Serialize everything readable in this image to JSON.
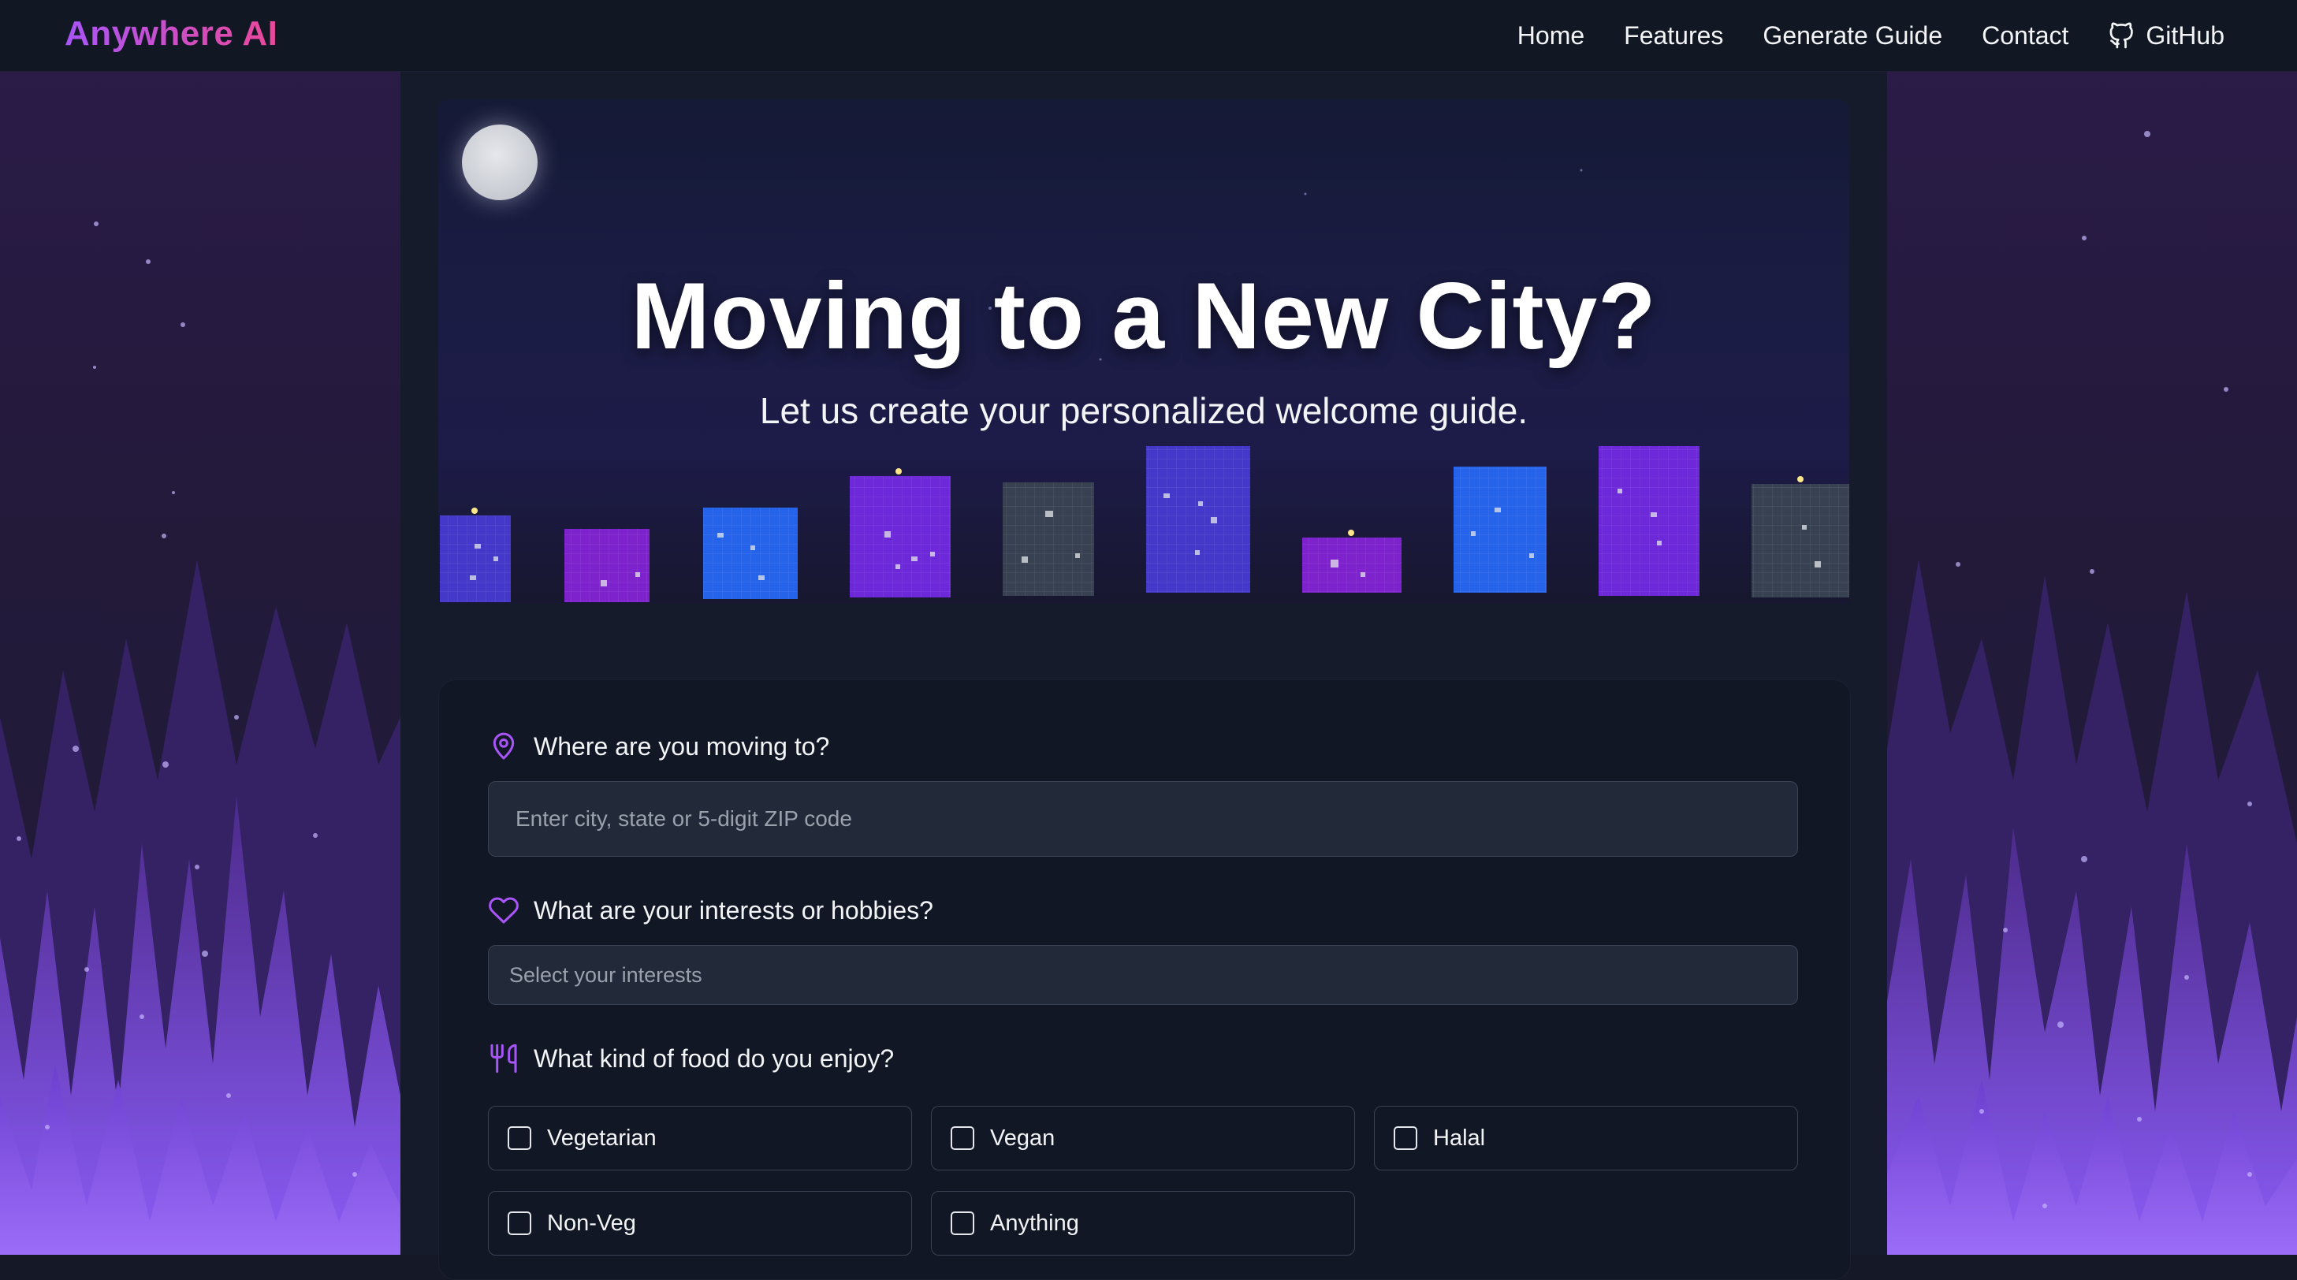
{
  "nav": {
    "brand": "Anywhere AI",
    "links": [
      "Home",
      "Features",
      "Generate Guide",
      "Contact"
    ],
    "github_label": "GitHub"
  },
  "hero": {
    "title": "Moving to a New City?",
    "subtitle": "Let us create your personalized welcome guide."
  },
  "form": {
    "location": {
      "label": "Where are you moving to?",
      "placeholder": "Enter city, state or 5-digit ZIP code"
    },
    "interests": {
      "label": "What are your interests or hobbies?",
      "placeholder": "Select your interests"
    },
    "food": {
      "label": "What kind of food do you enjoy?",
      "options": [
        "Vegetarian",
        "Vegan",
        "Halal",
        "Non-Veg",
        "Anything"
      ]
    }
  },
  "colors": {
    "accent": "#a855f7",
    "brand_gradient_end": "#ec4899",
    "background": "#141827",
    "card": "#121726",
    "field": "#222938"
  },
  "icons": {
    "location": "map-pin-icon",
    "interests": "heart-icon",
    "food": "utensils-icon",
    "github": "github-icon"
  }
}
